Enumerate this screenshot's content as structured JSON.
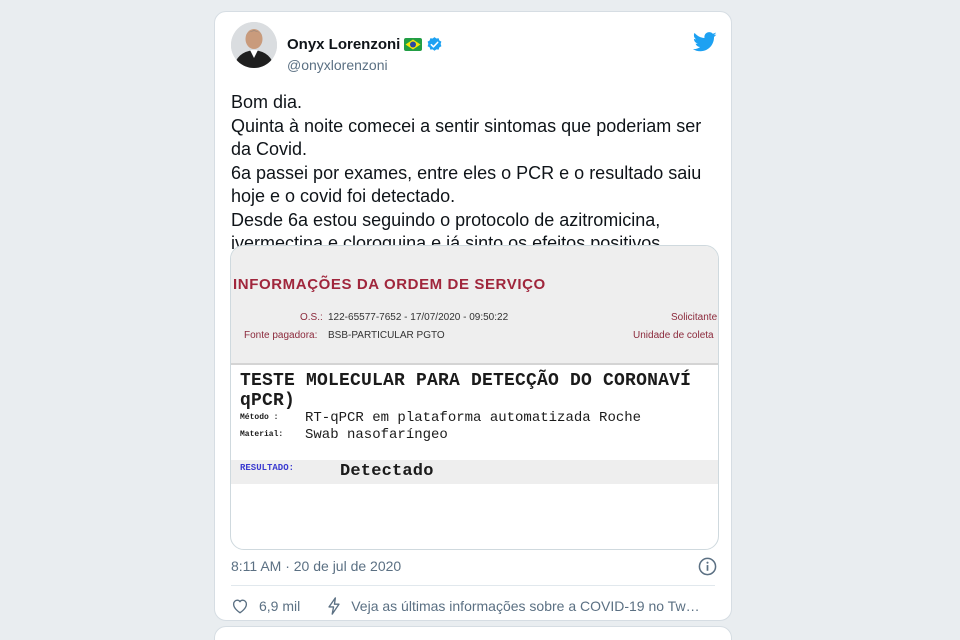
{
  "tweet": {
    "author_name": "Onyx Lorenzoni",
    "handle": "@onyxlorenzoni",
    "flag_icon": "brazil-flag-icon",
    "verified_icon": "verified-badge-icon",
    "brand_icon": "twitter-bird-icon",
    "text_lines": [
      "Bom dia.",
      "Quinta à noite comecei a sentir sintomas que poderiam ser",
      "da Covid.",
      "6a passei por exames, entre eles o PCR e o resultado saiu",
      "hoje e o covid foi detectado.",
      "Desde 6a estou seguindo o protocolo de azitromicina,",
      "ivermectina e cloroquina e já sinto os efeitos positivos."
    ],
    "timestamp": "8:11 AM · 20 de jul de 2020",
    "likes": "6,9 mil",
    "covid_notice": "Veja as últimas informações sobre a COVID-19 no Twi…"
  },
  "document": {
    "header": "INFORMAÇÕES DA ORDEM DE SERVIÇO",
    "os_label": "O.S.:",
    "os_value": "122-65577-7652 - 17/07/2020 - 09:50:22",
    "solicitante_label": "Solicitante",
    "fonte_label": "Fonte pagadora:",
    "fonte_value": "BSB-PARTICULAR PGTO",
    "unidade_label": "Unidade de coleta",
    "test_title_line1": "TESTE MOLECULAR PARA DETECÇÃO DO CORONAVÍ",
    "test_title_line2": "qPCR)",
    "metodo_label": "Método  :",
    "metodo_value": "RT-qPCR em plataforma automatizada Roche",
    "material_label": "Material:",
    "material_value": "Swab nasofaríngeo",
    "resultado_label": "RESULTADO:",
    "resultado_value": "Detectado"
  },
  "colors": {
    "background": "#e9edf0",
    "twitter_blue": "#1da1f2",
    "secondary_text": "#5b7083",
    "doc_header_red": "#a0263c",
    "resultado_blue": "#3a3ad0"
  }
}
